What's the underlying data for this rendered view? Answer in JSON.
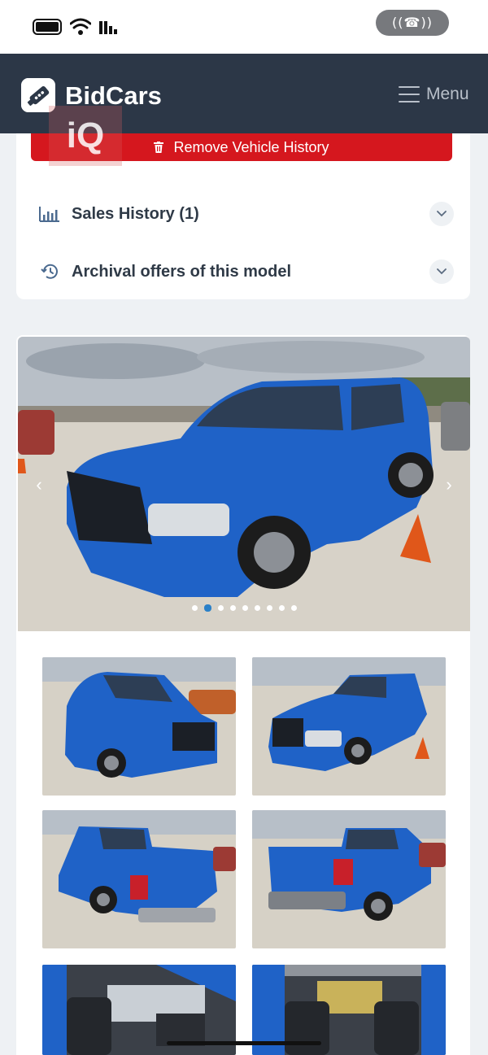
{
  "brand": {
    "name": "BidCars",
    "accent": "#2c3747"
  },
  "header": {
    "menu_label": "Menu"
  },
  "actions": {
    "remove_history_label": "Remove Vehicle History",
    "remove_color": "#d5171e"
  },
  "sections": [
    {
      "label": "Sales History (1)",
      "icon": "bar-chart-icon"
    },
    {
      "label": "Archival offers of this model",
      "icon": "history-icon"
    }
  ],
  "watermark": {
    "text": "iQ"
  },
  "gallery": {
    "total_photos": 9,
    "active_index": 1,
    "prev_glyph": "‹",
    "next_glyph": "›",
    "thumbnails": [
      {
        "subject": "front-left view"
      },
      {
        "subject": "front-right damaged view"
      },
      {
        "subject": "rear-left view"
      },
      {
        "subject": "rear-right view"
      },
      {
        "subject": "interior driver side"
      },
      {
        "subject": "interior rear seats"
      }
    ]
  }
}
